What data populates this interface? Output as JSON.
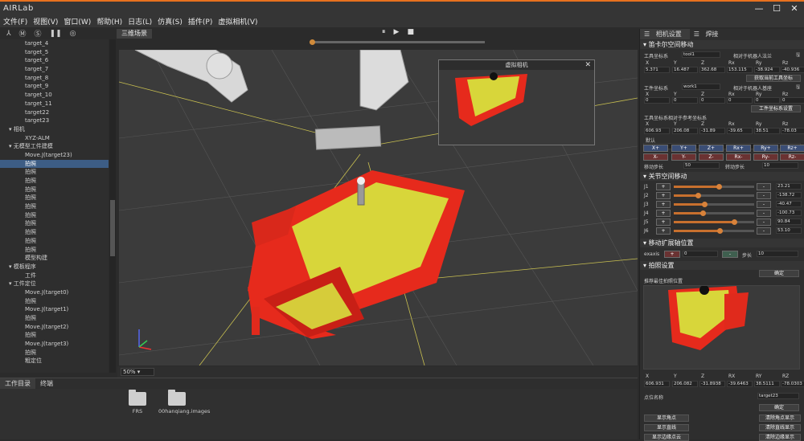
{
  "app": {
    "brand": "AIRLab"
  },
  "window_buttons": [
    "—",
    "☐",
    "✕"
  ],
  "menu": [
    "文件(F)",
    "视图(V)",
    "窗口(W)",
    "帮助(H)",
    "日志(L)",
    "仿真(S)",
    "插件(P)",
    "虚拟相机(V)"
  ],
  "toolbar_icons": [
    "axis-icon",
    "m-icon",
    "s-icon",
    "pause-icon",
    "target-icon"
  ],
  "tree": [
    {
      "label": "target_4",
      "indent": 3
    },
    {
      "label": "target_5",
      "indent": 3
    },
    {
      "label": "target_6",
      "indent": 3
    },
    {
      "label": "target_7",
      "indent": 3
    },
    {
      "label": "target_8",
      "indent": 3
    },
    {
      "label": "target_9",
      "indent": 3
    },
    {
      "label": "target_10",
      "indent": 3
    },
    {
      "label": "target_11",
      "indent": 3
    },
    {
      "label": "target22",
      "indent": 3
    },
    {
      "label": "target23",
      "indent": 3
    },
    {
      "label": "▾ 相机",
      "indent": 1
    },
    {
      "label": "XYZ-ALM",
      "indent": 3
    },
    {
      "label": "▾ 无模型工件建模",
      "indent": 1
    },
    {
      "label": "Move.J(target23)",
      "indent": 3
    },
    {
      "label": "拍照",
      "indent": 3,
      "selected": true
    },
    {
      "label": "拍照",
      "indent": 3
    },
    {
      "label": "拍照",
      "indent": 3
    },
    {
      "label": "拍照",
      "indent": 3
    },
    {
      "label": "拍照",
      "indent": 3
    },
    {
      "label": "拍照",
      "indent": 3
    },
    {
      "label": "拍照",
      "indent": 3
    },
    {
      "label": "拍照",
      "indent": 3
    },
    {
      "label": "拍照",
      "indent": 3
    },
    {
      "label": "拍照",
      "indent": 3
    },
    {
      "label": "拍照",
      "indent": 3
    },
    {
      "label": "模型构建",
      "indent": 3
    },
    {
      "label": "▾ 模板程序",
      "indent": 1
    },
    {
      "label": "工件",
      "indent": 3
    },
    {
      "label": "▾ 工件定位",
      "indent": 1
    },
    {
      "label": "Move.J(target0)",
      "indent": 3
    },
    {
      "label": "拍照",
      "indent": 3
    },
    {
      "label": "Move.J(target1)",
      "indent": 3
    },
    {
      "label": "拍照",
      "indent": 3
    },
    {
      "label": "Move.J(target2)",
      "indent": 3
    },
    {
      "label": "拍照",
      "indent": 3
    },
    {
      "label": "Move.J(target3)",
      "indent": 3
    },
    {
      "label": "拍照",
      "indent": 3
    },
    {
      "label": "粗定位",
      "indent": 3
    }
  ],
  "viewport": {
    "tab": "三维场景",
    "zoom": "50%",
    "axes": [
      "X",
      "Y",
      "Z"
    ]
  },
  "playback": {
    "pause": "⏸",
    "play": "▶",
    "stop": "■",
    "progress": 0.0
  },
  "virtual_camera": {
    "title": "虚拟相机",
    "close": "✕"
  },
  "bottom": {
    "tabs": [
      "工作目录",
      "终端"
    ],
    "files": [
      "FRS",
      "00hanqiang.images"
    ]
  },
  "right_panel": {
    "tabs": [
      "相机设置",
      "焊接"
    ],
    "cartesian": {
      "title": "笛卡尔空间移动",
      "tool_label": "工具坐标系",
      "tool_value": "tool1",
      "rel_robot_flange": "相对于机器人法兰",
      "headers": [
        "X",
        "Y",
        "Z",
        "Rx",
        "Ry",
        "Rz"
      ],
      "tool_vals": [
        "5.371",
        "16.487",
        "362.68",
        "153.115",
        "-38.924",
        "-40.936"
      ],
      "get_tool_btn": "获取当前工具坐标",
      "work_label": "工件坐标系",
      "work_value": "work1",
      "rel_robot_base": "相对于机器人基座",
      "work_vals": [
        "0",
        "0",
        "0",
        "0",
        "0",
        "0"
      ],
      "work_btn": "工件坐标系设置",
      "ref_label": "工具坐标系相对于参考坐标系",
      "ref_vals": [
        "606.93",
        "206.08",
        "-31.89",
        "-39.65",
        "38.51",
        "-78.03"
      ],
      "default_label": "默认",
      "plus": [
        "X+",
        "Y+",
        "Z+",
        "Rx+",
        "Ry+",
        "Rz+"
      ],
      "minus": [
        "X-",
        "Y-",
        "Z-",
        "Rx-",
        "Ry-",
        "Rz-"
      ],
      "move_step_label": "移动步长",
      "move_step": "50",
      "rot_step_label": "转动步长",
      "rot_step": "10"
    },
    "joint": {
      "title": "关节空间移动",
      "joints": [
        {
          "name": "J1",
          "value": "23.21",
          "level": 0.56
        },
        {
          "name": "J2",
          "value": "-138.72",
          "level": 0.3
        },
        {
          "name": "J3",
          "value": "-40.47",
          "level": 0.38
        },
        {
          "name": "J4",
          "value": "-100.73",
          "level": 0.36
        },
        {
          "name": "J5",
          "value": "90.84",
          "level": 0.75
        },
        {
          "name": "J6",
          "value": "53.10",
          "level": 0.57
        }
      ],
      "plus": "+",
      "minus": "-"
    },
    "extaxis": {
      "title": "移动扩展轴位置",
      "label": "exaxis",
      "plus": "+",
      "value": "0",
      "minus": "-",
      "step_label": "步长",
      "step": "10"
    },
    "photo": {
      "title": "拍照设置",
      "partial_btn": "确定",
      "recommend_label": "推荐最佳拍照位置",
      "headers": [
        "X",
        "Y",
        "Z",
        "RX",
        "RY",
        "RZ"
      ],
      "vals": [
        "606.931",
        "206.082",
        "-31.8938",
        "-39.6463",
        "38.5111",
        "-78.0303"
      ],
      "point_label": "点位名称",
      "point_value": "target23",
      "confirm": "确定",
      "show_corner": "显示角点",
      "clear_corner": "清除角点显示",
      "show_line": "显示直线",
      "clear_line": "清除直线显示",
      "show_edge": "显示边缘点云",
      "clear_edge": "清除边缘显示"
    }
  },
  "colors": {
    "accent": "#e8711e",
    "selection": "#3d5d85",
    "plus_btn": "#3a4d75",
    "minus_btn": "#6a3232",
    "red": "#e8281e",
    "yellow": "#e8e040"
  }
}
